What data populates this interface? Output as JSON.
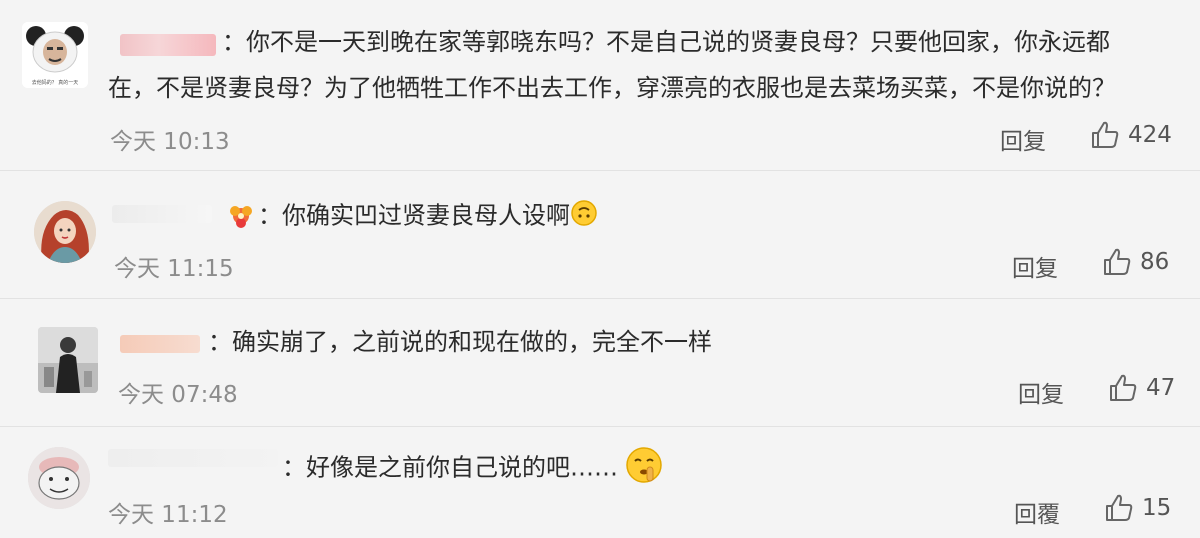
{
  "comments": [
    {
      "separator": "：",
      "lines": [
        "你不是一天到晚在家等郭晓东吗？不是自己说的贤妻良母？只要他回家，你永远都",
        "在，不是贤妻良母？为了他牺牲工作不出去工作，穿漂亮的衣服也是去菜场买菜，不是你说的？"
      ],
      "time": "今天 10:13",
      "reply_label": "回复",
      "likes": "424",
      "avatar_caption": "去他妈的？ 真的一天"
    },
    {
      "separator": "：",
      "lines": [
        "你确实凹过贤妻良母人设啊"
      ],
      "time": "今天 11:15",
      "reply_label": "回复",
      "likes": "86"
    },
    {
      "separator": "：",
      "lines": [
        "确实崩了，之前说的和现在做的，完全不一样"
      ],
      "time": "今天 07:48",
      "reply_label": "回复",
      "likes": "47"
    },
    {
      "separator": "：",
      "lines": [
        "好像是之前你自己说的吧……"
      ],
      "time": "今天 11:12",
      "reply_label": "回覆",
      "likes": "15"
    }
  ],
  "icons": {
    "like": "thumbs-up-icon",
    "upside_down": "upside-down-face-emoji",
    "shush": "shushing-face-emoji",
    "badge": "flower-badge-icon"
  },
  "colors": {
    "background": "#f4f4f4",
    "text": "#2b2b2b",
    "meta": "#8c8c8c"
  }
}
